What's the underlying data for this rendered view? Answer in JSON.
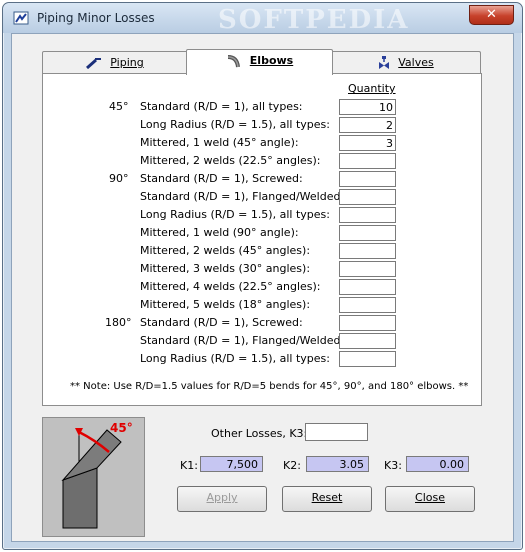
{
  "window": {
    "title": "Piping Minor Losses",
    "watermark": "SOFTPEDIA",
    "close_glyph": "✕"
  },
  "tabs": [
    {
      "label": "Piping",
      "icon": "pipe-icon",
      "active": false
    },
    {
      "label": "Elbows",
      "icon": "elbow-icon",
      "active": true
    },
    {
      "label": "Valves",
      "icon": "valve-icon",
      "active": false
    }
  ],
  "elbows": {
    "quantity_header": "Quantity",
    "rows": [
      {
        "angle": "45°",
        "label": "Standard (R/D = 1), all types:",
        "qty": "10"
      },
      {
        "angle": "",
        "label": "Long Radius (R/D = 1.5), all types:",
        "qty": "2"
      },
      {
        "angle": "",
        "label": "Mittered, 1 weld (45° angle):",
        "qty": "3"
      },
      {
        "angle": "",
        "label": "Mittered, 2 welds (22.5° angles):",
        "qty": ""
      },
      {
        "angle": "90°",
        "label": "Standard (R/D = 1), Screwed:",
        "qty": ""
      },
      {
        "angle": "",
        "label": "Standard (R/D = 1), Flanged/Welded:",
        "qty": ""
      },
      {
        "angle": "",
        "label": "Long Radius (R/D = 1.5), all types:",
        "qty": ""
      },
      {
        "angle": "",
        "label": "Mittered, 1 weld (90° angle):",
        "qty": ""
      },
      {
        "angle": "",
        "label": "Mittered, 2 welds (45° angles):",
        "qty": ""
      },
      {
        "angle": "",
        "label": "Mittered, 3 welds (30° angles):",
        "qty": ""
      },
      {
        "angle": "",
        "label": "Mittered, 4 welds (22.5° angles):",
        "qty": ""
      },
      {
        "angle": "",
        "label": "Mittered, 5 welds (18° angles):",
        "qty": ""
      },
      {
        "angle": "180°",
        "label": "Standard (R/D = 1), Screwed:",
        "qty": ""
      },
      {
        "angle": "",
        "label": "Standard (R/D = 1), Flanged/Welded:",
        "qty": ""
      },
      {
        "angle": "",
        "label": "Long Radius (R/D = 1.5), all types:",
        "qty": ""
      }
    ],
    "note": "** Note:  Use R/D=1.5 values for R/D=5 bends for 45°, 90°, and 180° elbows. **"
  },
  "diagram": {
    "angle_label": "45°",
    "accent_color": "#e00000"
  },
  "summary": {
    "other_losses_label": "Other Losses, K3:",
    "other_losses_value": "",
    "k1_label": "K1:",
    "k1_value": "7,500",
    "k2_label": "K2:",
    "k2_value": "3.05",
    "k3_label": "K3:",
    "k3_value": "0.00"
  },
  "buttons": {
    "apply": "Apply",
    "reset": "Reset",
    "close": "Close"
  },
  "colors": {
    "k_field_bg": "#c6c6f2",
    "close_button": "#c7412b"
  }
}
